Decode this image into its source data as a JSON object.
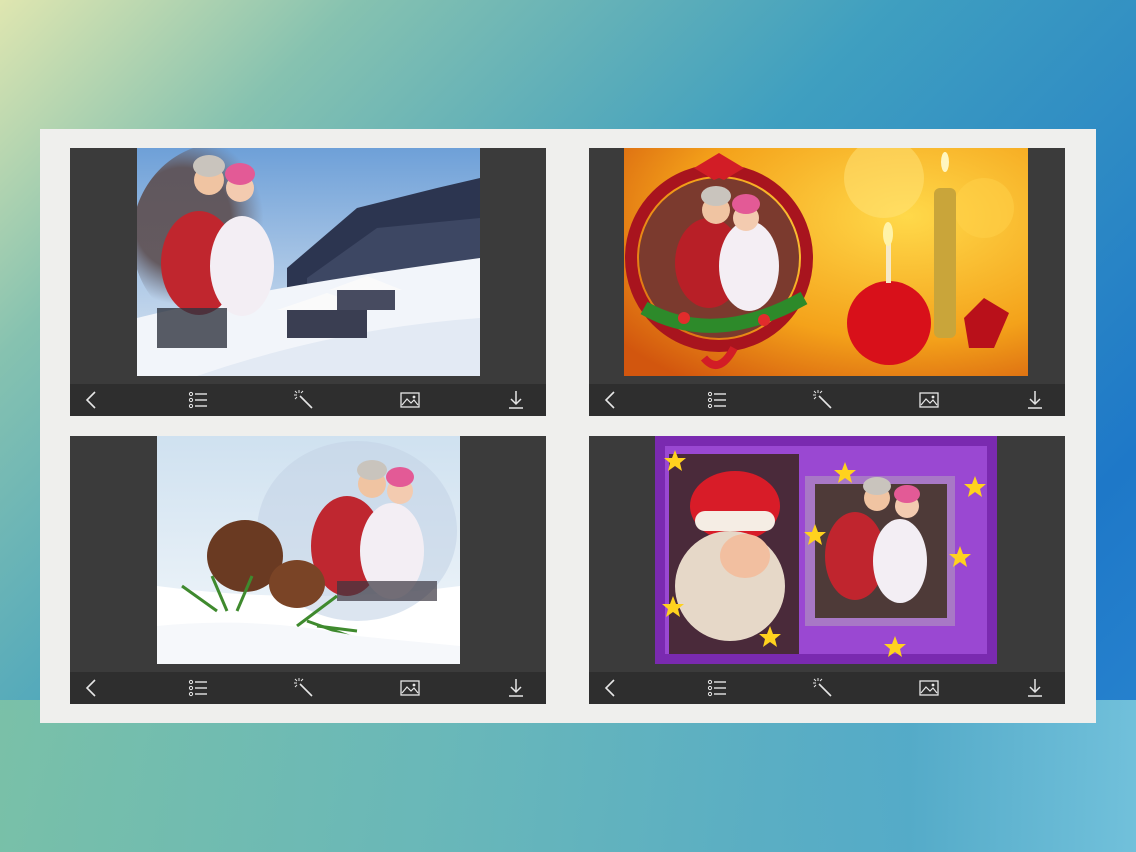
{
  "panels": [
    {
      "id": "winter-cabin",
      "toolbar": [
        "back-icon",
        "list-icon",
        "magic-wand-icon",
        "gallery-icon",
        "download-icon"
      ]
    },
    {
      "id": "christmas-wreath",
      "toolbar": [
        "back-icon",
        "list-icon",
        "magic-wand-icon",
        "gallery-icon",
        "download-icon"
      ]
    },
    {
      "id": "pinecone-snow",
      "toolbar": [
        "back-icon",
        "list-icon",
        "magic-wand-icon",
        "gallery-icon",
        "download-icon"
      ]
    },
    {
      "id": "purple-star-frame",
      "toolbar": [
        "back-icon",
        "list-icon",
        "magic-wand-icon",
        "gallery-icon",
        "download-icon"
      ]
    }
  ],
  "colors": {
    "panel_bg": "#3b3b3b",
    "toolbar_bg": "#2e2e2e",
    "sheet_bg": "#efefed",
    "icon": "#e6e6e6"
  }
}
